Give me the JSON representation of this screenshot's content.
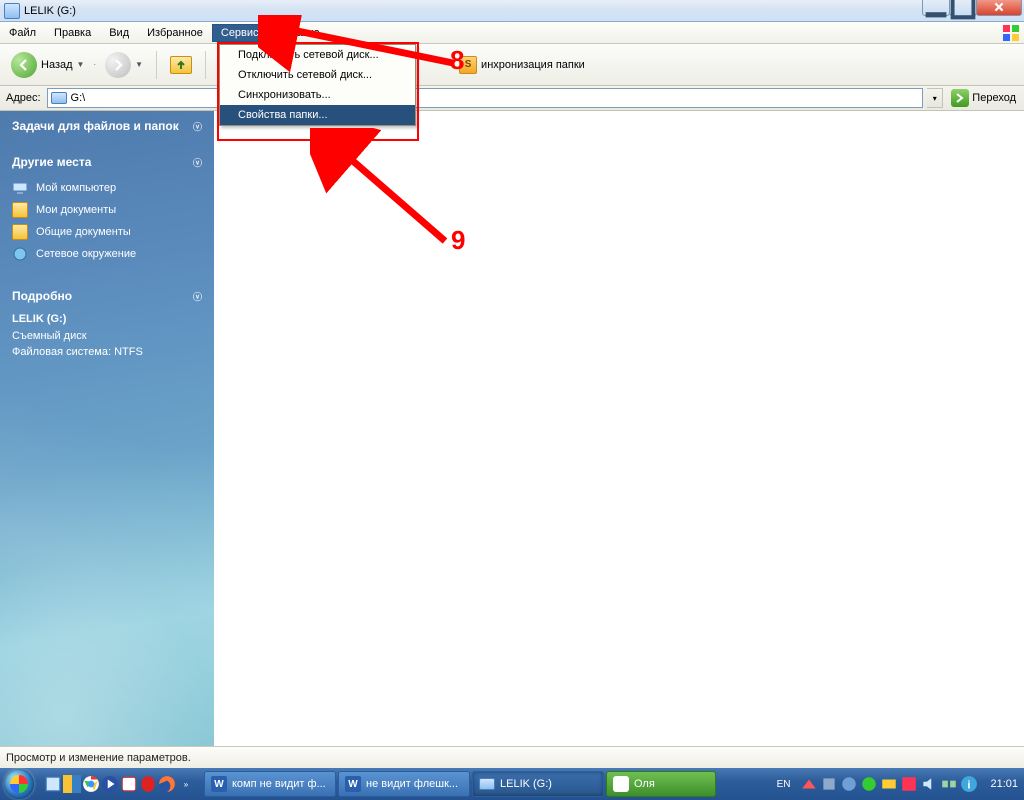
{
  "window": {
    "title": "LELIK (G:)"
  },
  "menubar": {
    "items": [
      "Файл",
      "Правка",
      "Вид",
      "Избранное",
      "Сервис",
      "Справка"
    ],
    "openIndex": 4
  },
  "dropdown": {
    "items": [
      "Подключить сетевой диск...",
      "Отключить сетевой диск...",
      "Синхронизовать...",
      "Свойства папки..."
    ],
    "highlightIndex": 3
  },
  "toolbar": {
    "back": "Назад",
    "syncFragment": "инхронизация папки"
  },
  "addressbar": {
    "label": "Адрес:",
    "path": "G:\\",
    "go": "Переход"
  },
  "sidebar": {
    "panels": {
      "tasks": {
        "title": "Задачи для файлов и папок"
      },
      "places": {
        "title": "Другие места",
        "items": [
          "Мой компьютер",
          "Мои документы",
          "Общие документы",
          "Сетевое окружение"
        ]
      },
      "details": {
        "title": "Подробно",
        "name": "LELIK (G:)",
        "type": "Съемный диск",
        "fs": "Файловая система: NTFS"
      }
    }
  },
  "statusbar": {
    "text": "Просмотр и изменение параметров."
  },
  "taskbar": {
    "tasks": [
      {
        "label": "комп не видит ф...",
        "app": "word"
      },
      {
        "label": "не видит флешк...",
        "app": "word"
      },
      {
        "label": "LELIK (G:)",
        "app": "explorer",
        "active": true
      },
      {
        "label": "Оля",
        "app": "im"
      }
    ],
    "lang": "EN",
    "clock": "21:01"
  },
  "annotations": {
    "num8": "8",
    "num9": "9"
  }
}
